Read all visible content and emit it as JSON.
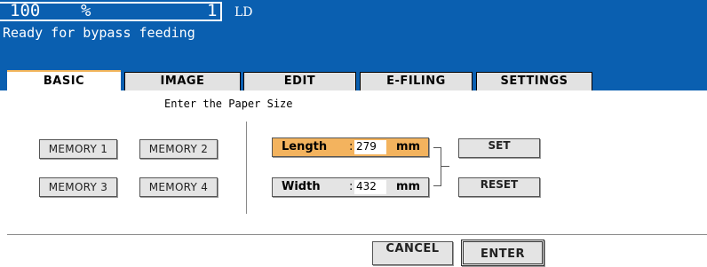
{
  "header": {
    "zoom_value": "100",
    "zoom_unit": "%",
    "copy_count": "1",
    "paper_size": "LD",
    "status": "Ready for bypass feeding",
    "background_color": "#0a5fb0"
  },
  "tabs": [
    {
      "label": "BASIC",
      "active": true
    },
    {
      "label": "IMAGE",
      "active": false
    },
    {
      "label": "EDIT",
      "active": false
    },
    {
      "label": "E-FILING",
      "active": false
    },
    {
      "label": "SETTINGS",
      "active": false
    }
  ],
  "hint": "Enter the Paper Size",
  "memory_buttons": [
    "MEMORY 1",
    "MEMORY 2",
    "MEMORY 3",
    "MEMORY 4"
  ],
  "length": {
    "label": "Length",
    "separator": ":",
    "value": "279",
    "unit": "mm",
    "selected": true,
    "highlight_color": "#f3b35e"
  },
  "width": {
    "label": "Width",
    "separator": ":",
    "value": "432",
    "unit": "mm",
    "selected": false
  },
  "actions": {
    "set": "SET",
    "reset": "RESET"
  },
  "footer": {
    "cancel": "CANCEL",
    "enter": "ENTER"
  }
}
